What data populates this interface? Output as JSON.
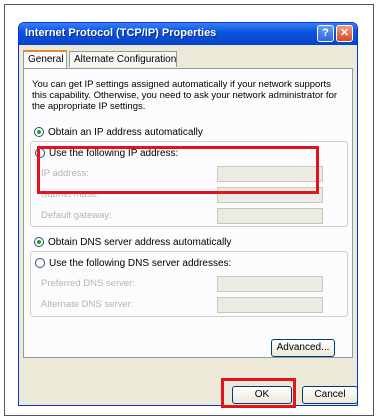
{
  "window": {
    "title": "Internet Protocol (TCP/IP) Properties",
    "help_icon": "?",
    "close_icon": "✕"
  },
  "tabs": [
    {
      "label": "General",
      "active": true
    },
    {
      "label": "Alternate Configuration",
      "active": false
    }
  ],
  "general": {
    "description": "You can get IP settings assigned automatically if your network supports this capability. Otherwise, you need to ask your network administrator for the appropriate IP settings.",
    "ip_auto_label": "Obtain an IP address automatically",
    "ip_auto_checked": true,
    "ip_manual_label": "Use the following IP address:",
    "ip_manual_checked": false,
    "ip_address_label": "IP address:",
    "subnet_label": "Subnet mask:",
    "gateway_label": "Default gateway:",
    "dns_auto_label": "Obtain DNS server address automatically",
    "dns_auto_checked": true,
    "dns_manual_label": "Use the following DNS server addresses:",
    "dns_manual_checked": false,
    "preferred_dns_label": "Preferred DNS server:",
    "alternate_dns_label": "Alternate DNS server:",
    "advanced_button": "Advanced..."
  },
  "footer": {
    "ok_button": "OK",
    "cancel_button": "Cancel"
  },
  "colors": {
    "highlight": "#e0141e",
    "titlebar": "#0a56e0"
  }
}
